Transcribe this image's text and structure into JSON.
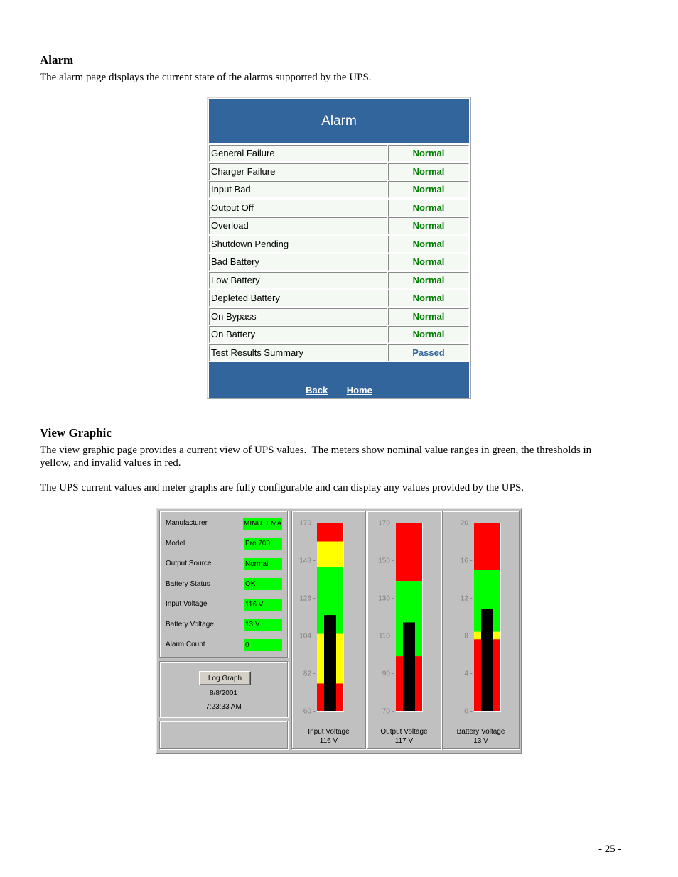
{
  "document": {
    "alarm_heading": "Alarm",
    "alarm_description": "The alarm page displays the current state of the alarms supported by the UPS.",
    "view_graphic_heading": "View Graphic",
    "view_graphic_paragraph_1": "The view graphic page provides a current view of UPS values.  The meters show nominal value ranges in green, the thresholds in yellow, and invalid values in red.",
    "view_graphic_paragraph_2": "The UPS current values and meter graphs are fully configurable and can display any values provided by the UPS.",
    "page_number": "- 25 -"
  },
  "alarm_panel": {
    "title": "Alarm",
    "rows": [
      {
        "label": "General Failure",
        "status": "Normal"
      },
      {
        "label": "Charger Failure",
        "status": "Normal"
      },
      {
        "label": "Input Bad",
        "status": "Normal"
      },
      {
        "label": "Output Off",
        "status": "Normal"
      },
      {
        "label": "Overload",
        "status": "Normal"
      },
      {
        "label": "Shutdown Pending",
        "status": "Normal"
      },
      {
        "label": "Bad Battery",
        "status": "Normal"
      },
      {
        "label": "Low Battery",
        "status": "Normal"
      },
      {
        "label": "Depleted Battery",
        "status": "Normal"
      },
      {
        "label": "On Bypass",
        "status": "Normal"
      },
      {
        "label": "On Battery",
        "status": "Normal"
      },
      {
        "label": "Test Results Summary",
        "status": "Passed"
      }
    ],
    "status_colors": {
      "Normal": "#008000",
      "Passed": "#31659b"
    },
    "footer_links": {
      "back": "Back",
      "home": "Home"
    }
  },
  "view_graphic": {
    "values": [
      {
        "label": "Manufacturer",
        "value": "MINUTEMAN"
      },
      {
        "label": "Model",
        "value": "Pro 700"
      },
      {
        "label": "Output Source",
        "value": "Normal"
      },
      {
        "label": "Battery Status",
        "value": "OK"
      },
      {
        "label": "Input Voltage",
        "value": "116 V"
      },
      {
        "label": "Battery Voltage",
        "value": "13 V"
      },
      {
        "label": "Alarm Count",
        "value": "0"
      }
    ],
    "log_graph_button": "Log Graph",
    "date": "8/8/2001",
    "time": "7:23:33 AM",
    "zone_colors": {
      "red": "#ff0000",
      "yellow": "#ffff00",
      "green": "#00ff00"
    },
    "bar_color": "#000000",
    "meters": [
      {
        "label": "Input Voltage",
        "value_text": "116 V",
        "min": 60,
        "max": 170,
        "ticks": [
          170,
          148,
          126,
          104,
          82,
          60
        ],
        "bar_value": 116,
        "zones": [
          {
            "from": 159,
            "to": 170,
            "color": "red"
          },
          {
            "from": 144,
            "to": 159,
            "color": "yellow"
          },
          {
            "from": 105,
            "to": 144,
            "color": "green"
          },
          {
            "from": 76,
            "to": 105,
            "color": "yellow"
          },
          {
            "from": 60,
            "to": 76,
            "color": "red"
          }
        ]
      },
      {
        "label": "Output Voltage",
        "value_text": "117 V",
        "min": 70,
        "max": 170,
        "ticks": [
          170,
          150,
          130,
          110,
          90,
          70
        ],
        "bar_value": 117,
        "zones": [
          {
            "from": 139,
            "to": 170,
            "color": "red"
          },
          {
            "from": 99,
            "to": 139,
            "color": "green"
          },
          {
            "from": 70,
            "to": 99,
            "color": "red"
          }
        ]
      },
      {
        "label": "Battery Voltage",
        "value_text": "13 V",
        "min": 0,
        "max": 20,
        "ticks": [
          20,
          16,
          12,
          8,
          4,
          0
        ],
        "bar_value": 10.8,
        "zones": [
          {
            "from": 15,
            "to": 20,
            "color": "red"
          },
          {
            "from": 8.4,
            "to": 15,
            "color": "green"
          },
          {
            "from": 7.6,
            "to": 8.4,
            "color": "yellow"
          },
          {
            "from": 0,
            "to": 7.6,
            "color": "red"
          }
        ]
      }
    ]
  }
}
